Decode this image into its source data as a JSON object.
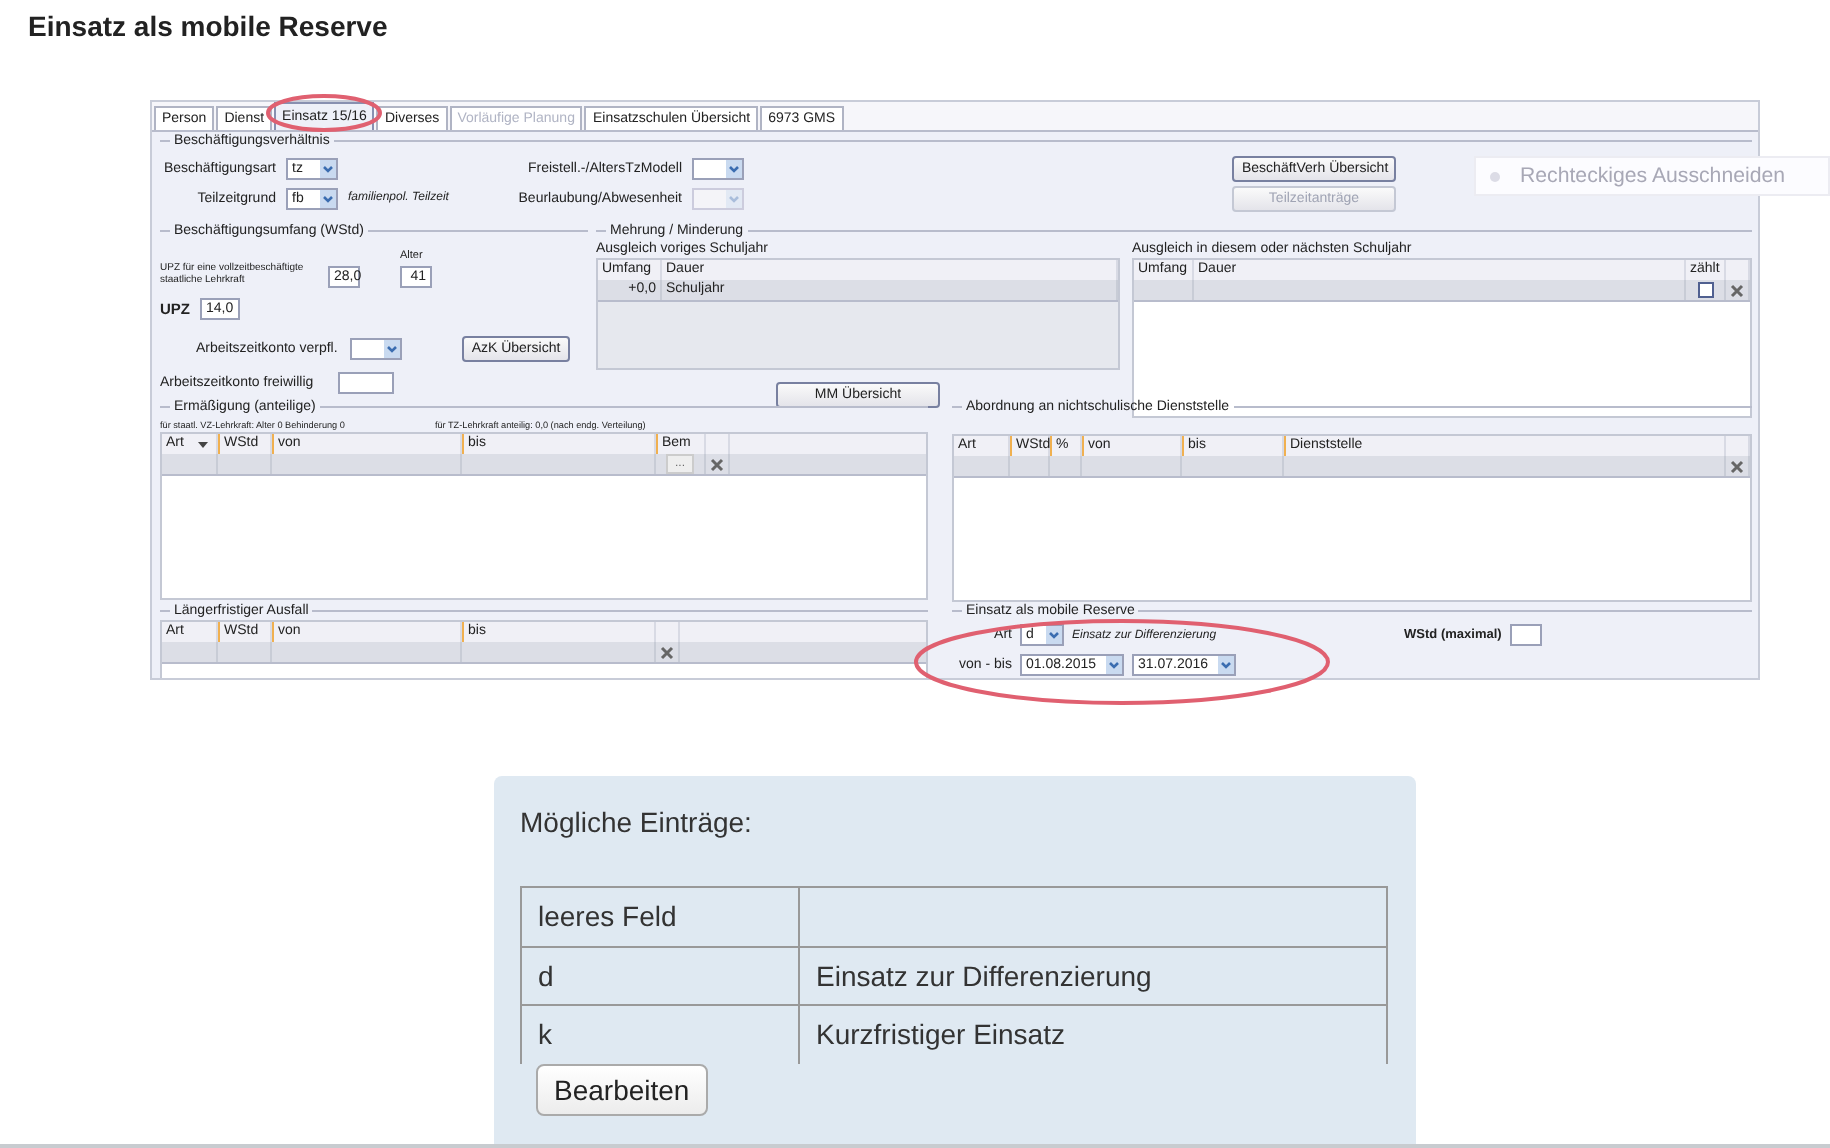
{
  "heading": "Einsatz als mobile Reserve",
  "app": {
    "tabs": [
      {
        "label": "Person",
        "selected": false,
        "disabled": false
      },
      {
        "label": "Dienst",
        "selected": false,
        "disabled": false
      },
      {
        "label": "Einsatz 15/16",
        "selected": true,
        "disabled": false
      },
      {
        "label": "Diverses",
        "selected": false,
        "disabled": false
      },
      {
        "label": "Vorläufige Planung",
        "selected": false,
        "disabled": true
      },
      {
        "label": "Einsatzschulen Übersicht",
        "selected": false,
        "disabled": false
      },
      {
        "label": "6973 GMS",
        "selected": false,
        "disabled": false
      }
    ],
    "employment": {
      "title": "Beschäftigungsverhältnis",
      "fields": [
        {
          "label": "Beschäftigungsart",
          "value": "tz",
          "disabled": false
        },
        {
          "label": "Teilzeitgrund",
          "value": "fb",
          "note": "familienpol. Teilzeit",
          "disabled": false
        },
        {
          "label": "Freistell.-/AltersTzModell",
          "disabled": false
        },
        {
          "label": "Beurlaubung/Abwesenheit",
          "disabled": true
        }
      ],
      "buttons": [
        {
          "label": "BeschäftVerh Übersicht",
          "disabled": false
        },
        {
          "label": "Teilzeitanträge",
          "disabled": true
        }
      ]
    },
    "scope": {
      "title": "Beschäftigungsumfang (WStd)",
      "upz_note": "UPZ für eine vollzeitbeschäftigte staatliche Lehrkraft",
      "upz_full": "28,0",
      "age_label": "Alter",
      "age": "41",
      "upz_label": "UPZ",
      "upz": "14,0",
      "account_required_label": "Arbeitszeitkonto verpfl.",
      "account_button": "AzK Übersicht",
      "account_voluntary_label": "Arbeitszeitkonto freiwillig"
    },
    "mm": {
      "title": "Mehrung / Minderung",
      "previous": {
        "title": "Ausgleich voriges Schuljahr",
        "columns": [
          "Umfang",
          "Dauer"
        ],
        "rows": [
          [
            "+0,0",
            "Schuljahr"
          ]
        ]
      },
      "button": "MM Übersicht",
      "next": {
        "title": "Ausgleich in diesem oder nächsten Schuljahr",
        "columns": [
          "Umfang",
          "Dauer",
          "zählt"
        ],
        "checked": false
      }
    },
    "reduction": {
      "title": "Ermäßigung (anteilige)",
      "notes": [
        "für staatl. VZ-Lehrkraft: Alter 0 Behinderung 0",
        "für TZ-Lehrkraft anteilig: 0,0 (nach endg. Verteilung)"
      ],
      "columns": [
        "Art",
        "WStd",
        "von",
        "bis",
        "Bem"
      ],
      "edit_button": "..."
    },
    "secondment": {
      "title": "Abordnung an nichtschulische Dienststelle",
      "columns": [
        "Art",
        "WStd",
        "%",
        "von",
        "bis",
        "Dienststelle"
      ]
    },
    "absence": {
      "title": "Längerfristiger Ausfall",
      "columns": [
        "Art",
        "WStd",
        "von",
        "bis"
      ]
    },
    "reserve": {
      "title": "Einsatz als mobile Reserve",
      "art_label": "Art",
      "art": "d",
      "art_note": "Einsatz zur Differenzierung",
      "hours_label": "WStd (maximal)",
      "range_label": "von - bis",
      "from": "01.08.2015",
      "to": "31.07.2016"
    }
  },
  "snip_tool": {
    "label": "Rechteckiges Ausschneiden"
  },
  "info": {
    "title": "Mögliche Einträge:",
    "rows": [
      {
        "code": "leeres Feld"
      },
      {
        "code": "d",
        "meaning": "Einsatz zur Differenzierung"
      },
      {
        "code": "k",
        "meaning": "Kurzfristiger Einsatz"
      }
    ],
    "button": "Bearbeiten"
  }
}
